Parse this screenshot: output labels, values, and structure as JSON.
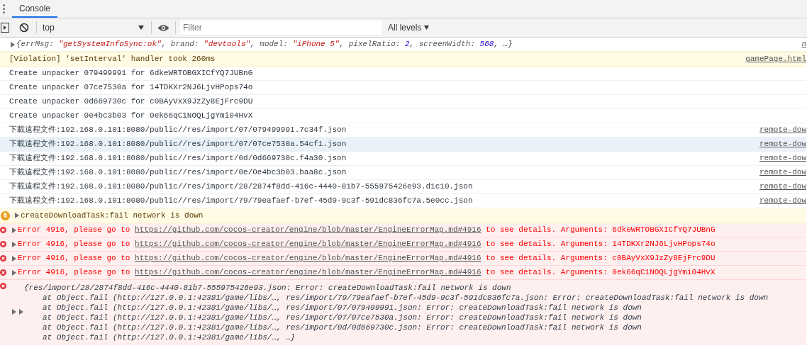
{
  "tabs": [
    {
      "label": "Console",
      "selected": true
    }
  ],
  "toolbar": {
    "context": "top",
    "filter": {
      "placeholder": "Filter"
    },
    "levels": "All levels"
  },
  "messages": [
    {
      "kind": "object",
      "expanded": false,
      "parts": [
        {
          "kind": "punct",
          "text": "{"
        },
        {
          "kind": "key",
          "text": "errMsg: "
        },
        {
          "kind": "string",
          "text": "\"getSystemInfoSync:ok\""
        },
        {
          "kind": "punct",
          "text": ", "
        },
        {
          "kind": "key",
          "text": "brand: "
        },
        {
          "kind": "string",
          "text": "\"devtools\""
        },
        {
          "kind": "punct",
          "text": ", "
        },
        {
          "kind": "key",
          "text": "model: "
        },
        {
          "kind": "string",
          "text": "\"iPhone 5\""
        },
        {
          "kind": "punct",
          "text": ", "
        },
        {
          "kind": "key",
          "text": "pixelRatio: "
        },
        {
          "kind": "number",
          "text": "2"
        },
        {
          "kind": "punct",
          "text": ", "
        },
        {
          "kind": "key",
          "text": "screenWidth: "
        },
        {
          "kind": "number",
          "text": "568"
        },
        {
          "kind": "punct",
          "text": ", …}"
        }
      ],
      "source": "n"
    },
    {
      "kind": "violation",
      "text": "[Violation] 'setInterval' handler took 260ms",
      "source": "gamePage.html"
    },
    {
      "kind": "log",
      "text": "Create unpacker 079499991 for 6dkeWRTOBGXICfYQ7JUBnG",
      "selected": false
    },
    {
      "kind": "log",
      "text": "Create unpacker 07ce7530a for 14TDKXr2NJ6LjvHPops74o",
      "selected": false
    },
    {
      "kind": "log",
      "text": "Create unpacker 0d669730c for c0BAyVxX9JzZy8EjFrc9DU",
      "selected": false
    },
    {
      "kind": "log",
      "text": "Create unpacker 0e4bc3b03 for 0ek66qC1NOQLjgYmi04HvX",
      "selected": false
    },
    {
      "kind": "log",
      "text": "下載遠程文件:192.168.0.101:8080/public//res/import/07/079499991.7c34f.json",
      "source": "remote-dow",
      "selected": false
    },
    {
      "kind": "log",
      "text": "下載遠程文件:192.168.0.101:8080/public//res/import/07/07ce7530a.54cf1.json",
      "source": "remote-dow",
      "selected": true
    },
    {
      "kind": "log",
      "text": "下載遠程文件:192.168.0.101:8080/public//res/import/0d/0d669730c.f4a30.json",
      "source": "remote-dow",
      "selected": false
    },
    {
      "kind": "log",
      "text": "下載遠程文件:192.168.0.101:8080/public//res/import/0e/0e4bc3b03.baa8c.json",
      "source": "remote-dow",
      "selected": false
    },
    {
      "kind": "log",
      "text": "下載遠程文件:192.168.0.101:8080/public//res/import/28/2874f8dd-416c-4440-81b7-555975426e93.d1c10.json",
      "source": "remote-dow",
      "selected": false
    },
    {
      "kind": "log",
      "text": "下載遠程文件:192.168.0.101:8080/public//res/import/79/79eafaef-b7ef-45d9-9c3f-591dc836fc7a.5e0cc.json",
      "source": "remote-dow",
      "selected": false
    },
    {
      "kind": "warning",
      "count": "6",
      "expanded": false,
      "text": "createDownloadTask:fail network is down"
    },
    {
      "kind": "error",
      "expanded": false,
      "before": "Error 4916, please go to ",
      "link": "https://github.com/cocos-creator/engine/blob/master/EngineErrorMap.md#4916",
      "after": " to see details. Arguments: 6dkeWRTOBGXICfYQ7JUBnG"
    },
    {
      "kind": "error",
      "expanded": false,
      "before": "Error 4916, please go to ",
      "link": "https://github.com/cocos-creator/engine/blob/master/EngineErrorMap.md#4916",
      "after": " to see details. Arguments: 14TDKXr2NJ6LjvHPops74o"
    },
    {
      "kind": "error",
      "expanded": false,
      "before": "Error 4916, please go to ",
      "link": "https://github.com/cocos-creator/engine/blob/master/EngineErrorMap.md#4916",
      "after": " to see details. Arguments: c0BAyVxX9JzZy8EjFrc9DU"
    },
    {
      "kind": "error",
      "expanded": false,
      "before": "Error 4916, please go to ",
      "link": "https://github.com/cocos-creator/engine/blob/master/EngineErrorMap.md#4916",
      "after": " to see details. Arguments: 0ek66qC1NOQLjgYmi04HvX"
    },
    {
      "kind": "stack",
      "expanded": false,
      "head": "{res/import/28/2874f8dd-416c-4440-81b7-555975426e93.json: Error: createDownloadTask:fail network is down",
      "lines": [
        "at Object.fail (http://127.0.0.1:42381/game/libs/…, res/import/79/79eafaef-b7ef-45d9-9c3f-591dc836fc7a.json: Error: createDownloadTask:fail network is down",
        "at Object.fail (http://127.0.0.1:42381/game/libs/…, res/import/07/079499991.json: Error: createDownloadTask:fail network is down",
        "at Object.fail (http://127.0.0.1:42381/game/libs/…, res/import/07/07ce7530a.json: Error: createDownloadTask:fail network is down",
        "at Object.fail (http://127.0.0.1:42381/game/libs/…, res/import/0d/0d669730c.json: Error: createDownloadTask:fail network is down",
        "at Object.fail (http://127.0.0.1:42381/game/libs/…, …}"
      ]
    }
  ]
}
